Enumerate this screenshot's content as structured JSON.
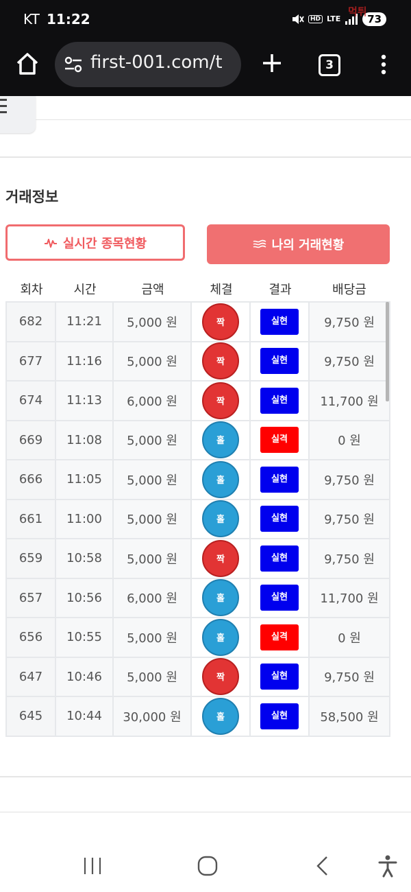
{
  "status_bar": {
    "carrier": "KT",
    "time": "11:22",
    "network": "LTE",
    "hd": "HD",
    "battery": "73",
    "watermark": "먹튀"
  },
  "browser": {
    "url": "first-001.com/t",
    "tab_count": "3"
  },
  "section": {
    "title": "거래정보"
  },
  "buttons": {
    "realtime": "실시간 종목현황",
    "my_trades": "나의 거래현황"
  },
  "table": {
    "headers": [
      "회차",
      "시간",
      "금액",
      "체결",
      "결과",
      "배당금"
    ],
    "rows": [
      {
        "round": "682",
        "time": "11:21",
        "amount": "5,000 원",
        "pick": "짝",
        "result": "실현",
        "payout": "9,750 원"
      },
      {
        "round": "677",
        "time": "11:16",
        "amount": "5,000 원",
        "pick": "짝",
        "result": "실현",
        "payout": "9,750 원"
      },
      {
        "round": "674",
        "time": "11:13",
        "amount": "6,000 원",
        "pick": "짝",
        "result": "실현",
        "payout": "11,700 원"
      },
      {
        "round": "669",
        "time": "11:08",
        "amount": "5,000 원",
        "pick": "홀",
        "result": "실격",
        "payout": "0 원"
      },
      {
        "round": "666",
        "time": "11:05",
        "amount": "5,000 원",
        "pick": "홀",
        "result": "실현",
        "payout": "9,750 원"
      },
      {
        "round": "661",
        "time": "11:00",
        "amount": "5,000 원",
        "pick": "홀",
        "result": "실현",
        "payout": "9,750 원"
      },
      {
        "round": "659",
        "time": "10:58",
        "amount": "5,000 원",
        "pick": "짝",
        "result": "실현",
        "payout": "9,750 원"
      },
      {
        "round": "657",
        "time": "10:56",
        "amount": "6,000 원",
        "pick": "홀",
        "result": "실현",
        "payout": "11,700 원"
      },
      {
        "round": "656",
        "time": "10:55",
        "amount": "5,000 원",
        "pick": "홀",
        "result": "실격",
        "payout": "0 원"
      },
      {
        "round": "647",
        "time": "10:46",
        "amount": "5,000 원",
        "pick": "짝",
        "result": "실현",
        "payout": "9,750 원"
      },
      {
        "round": "645",
        "time": "10:44",
        "amount": "30,000 원",
        "pick": "홀",
        "result": "실현",
        "payout": "58,500 원"
      }
    ]
  },
  "colors": {
    "even_ball": "#e23434",
    "odd_ball": "#2a9fd6",
    "win_badge": "#0000ee",
    "lose_badge": "#ff0000",
    "accent": "#f07071"
  },
  "icons": {
    "home": "home-icon",
    "site_settings": "tune-icon",
    "new_tab": "plus-icon",
    "menu": "more-vert-icon",
    "hamburger": "hamburger-icon",
    "pulse": "pulse-icon",
    "list": "list-icon",
    "recents": "recents-icon",
    "home_nav": "home-nav-icon",
    "back": "back-icon",
    "accessibility": "accessibility-icon"
  }
}
